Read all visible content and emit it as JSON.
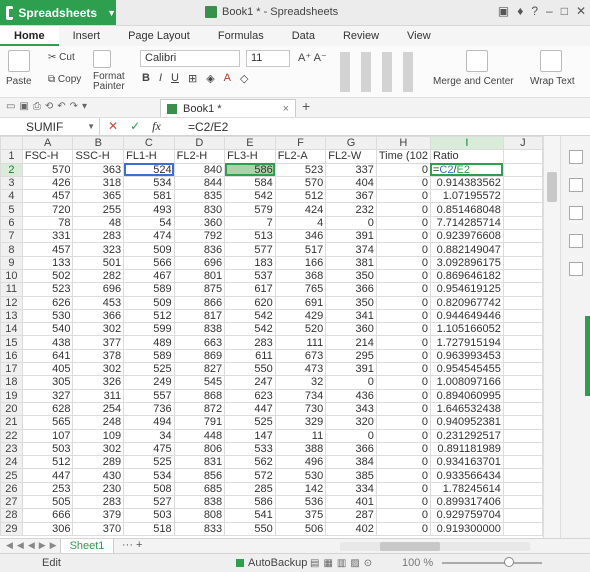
{
  "app": {
    "name": "Spreadsheets",
    "doc_title": "Book1 * - Spreadsheets"
  },
  "ribbon_tabs": [
    "Home",
    "Insert",
    "Page Layout",
    "Formulas",
    "Data",
    "Review",
    "View"
  ],
  "ribbon": {
    "paste": "Paste",
    "cut": "Cut",
    "copy": "Copy",
    "format_painter": "Format Painter",
    "font": "Calibri",
    "size": "11",
    "merge_center": "Merge and Center",
    "wrap_text": "Wrap Text"
  },
  "doc_tab": "Book1 *",
  "formula_bar": {
    "name_box": "SUMIF",
    "formula": "=C2/E2"
  },
  "columns": [
    "A",
    "B",
    "C",
    "D",
    "E",
    "F",
    "G",
    "H",
    "I",
    "J"
  ],
  "headers": [
    "FSC-H",
    "SSC-H",
    "FL1-H",
    "FL2-H",
    "FL3-H",
    "FL2-A",
    "FL2-W",
    "Time (102",
    "Ratio",
    ""
  ],
  "rows": [
    [
      "570",
      "363",
      "524",
      "840",
      "586",
      "523",
      "337",
      "0",
      "=C2/E2"
    ],
    [
      "426",
      "318",
      "534",
      "844",
      "584",
      "570",
      "404",
      "0",
      "0.914383562"
    ],
    [
      "457",
      "365",
      "581",
      "835",
      "542",
      "512",
      "367",
      "0",
      "1.07195572"
    ],
    [
      "720",
      "255",
      "493",
      "830",
      "579",
      "424",
      "232",
      "0",
      "0.851468048"
    ],
    [
      "78",
      "48",
      "54",
      "360",
      "7",
      "4",
      "0",
      "0",
      "7.714285714"
    ],
    [
      "331",
      "283",
      "474",
      "792",
      "513",
      "346",
      "391",
      "0",
      "0.923976608"
    ],
    [
      "457",
      "323",
      "509",
      "836",
      "577",
      "517",
      "374",
      "0",
      "0.882149047"
    ],
    [
      "133",
      "501",
      "566",
      "696",
      "183",
      "166",
      "381",
      "0",
      "3.092896175"
    ],
    [
      "502",
      "282",
      "467",
      "801",
      "537",
      "368",
      "350",
      "0",
      "0.869646182"
    ],
    [
      "523",
      "696",
      "589",
      "875",
      "617",
      "765",
      "366",
      "0",
      "0.954619125"
    ],
    [
      "626",
      "453",
      "509",
      "866",
      "620",
      "691",
      "350",
      "0",
      "0.820967742"
    ],
    [
      "530",
      "366",
      "512",
      "817",
      "542",
      "429",
      "341",
      "0",
      "0.944649446"
    ],
    [
      "540",
      "302",
      "599",
      "838",
      "542",
      "520",
      "360",
      "0",
      "1.105166052"
    ],
    [
      "438",
      "377",
      "489",
      "663",
      "283",
      "111",
      "214",
      "0",
      "1.727915194"
    ],
    [
      "641",
      "378",
      "589",
      "869",
      "611",
      "673",
      "295",
      "0",
      "0.963993453"
    ],
    [
      "405",
      "302",
      "525",
      "827",
      "550",
      "473",
      "391",
      "0",
      "0.954545455"
    ],
    [
      "305",
      "326",
      "249",
      "545",
      "247",
      "32",
      "0",
      "0",
      "1.008097166"
    ],
    [
      "327",
      "311",
      "557",
      "868",
      "623",
      "734",
      "436",
      "0",
      "0.894060995"
    ],
    [
      "628",
      "254",
      "736",
      "872",
      "447",
      "730",
      "343",
      "0",
      "1.646532438"
    ],
    [
      "565",
      "248",
      "494",
      "791",
      "525",
      "329",
      "320",
      "0",
      "0.940952381"
    ],
    [
      "107",
      "109",
      "34",
      "448",
      "147",
      "11",
      "0",
      "0",
      "0.231292517"
    ],
    [
      "503",
      "302",
      "475",
      "806",
      "533",
      "388",
      "366",
      "0",
      "0.891181989"
    ],
    [
      "512",
      "289",
      "525",
      "831",
      "562",
      "496",
      "384",
      "0",
      "0.934163701"
    ],
    [
      "447",
      "430",
      "534",
      "856",
      "572",
      "530",
      "385",
      "0",
      "0.933566434"
    ],
    [
      "253",
      "230",
      "508",
      "685",
      "285",
      "142",
      "334",
      "0",
      "1.78245614"
    ],
    [
      "505",
      "283",
      "527",
      "838",
      "586",
      "536",
      "401",
      "0",
      "0.899317406"
    ],
    [
      "666",
      "379",
      "503",
      "808",
      "541",
      "375",
      "287",
      "0",
      "0.929759704"
    ],
    [
      "306",
      "370",
      "518",
      "833",
      "550",
      "506",
      "402",
      "0",
      "0.919300000"
    ]
  ],
  "sheet_tab": "Sheet1",
  "status": {
    "mode": "Edit",
    "autobackup": "AutoBackup",
    "zoom": "100 %"
  },
  "colors": {
    "accent": "#2e9e4f",
    "ref_blue": "#3b6fd6",
    "ref_fill": "#a8d4a8"
  }
}
